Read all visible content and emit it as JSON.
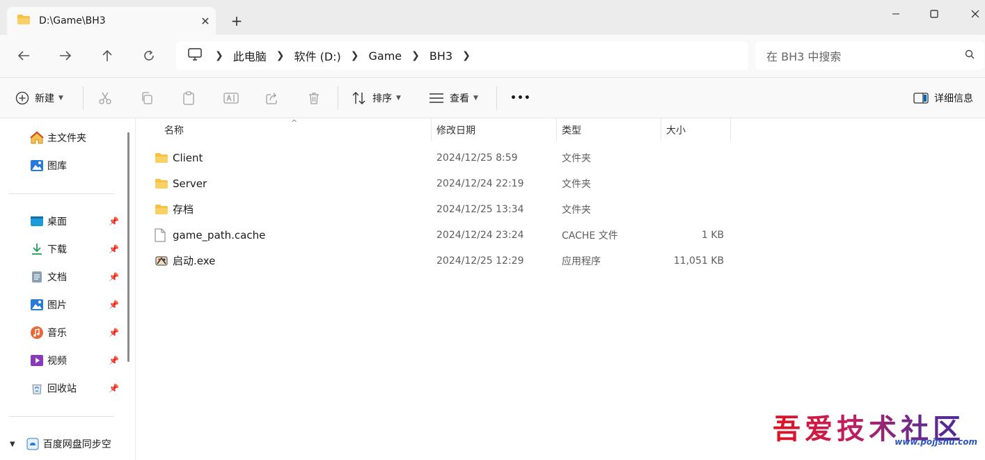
{
  "tab": {
    "title": "D:\\Game\\BH3",
    "close": "✕",
    "new_tab": "+"
  },
  "window": {
    "minimize": "—",
    "maximize": "☐",
    "close": "✕"
  },
  "breadcrumb": [
    "此电脑",
    "软件 (D:)",
    "Game",
    "BH3"
  ],
  "search": {
    "placeholder": "在 BH3 中搜索"
  },
  "toolbar": {
    "new_label": "新建",
    "sort_label": "排序",
    "view_label": "查看",
    "more_label": "•••",
    "details_label": "详细信息"
  },
  "sidebar": {
    "home": "主文件夹",
    "gallery": "图库",
    "pinned": [
      "桌面",
      "下载",
      "文档",
      "图片",
      "音乐",
      "视频",
      "回收站"
    ],
    "cloud": "百度网盘同步空"
  },
  "columns": {
    "name": "名称",
    "date": "修改日期",
    "type": "类型",
    "size": "大小"
  },
  "files": [
    {
      "name": "Client",
      "date": "2024/12/25 8:59",
      "type": "文件夹",
      "size": "",
      "icon": "folder-icon"
    },
    {
      "name": "Server",
      "date": "2024/12/24 22:19",
      "type": "文件夹",
      "size": "",
      "icon": "folder-icon"
    },
    {
      "name": "存档",
      "date": "2024/12/25 13:34",
      "type": "文件夹",
      "size": "",
      "icon": "folder-icon"
    },
    {
      "name": "game_path.cache",
      "date": "2024/12/24 23:24",
      "type": "CACHE 文件",
      "size": "1 KB",
      "icon": "file-icon"
    },
    {
      "name": "启动.exe",
      "date": "2024/12/25 12:29",
      "type": "应用程序",
      "size": "11,051 KB",
      "icon": "exe-icon"
    }
  ],
  "watermark": {
    "text": "吾爱技术社区",
    "url": "www.pojjshu.com"
  },
  "colors": {
    "folder": "#f5c242",
    "accent": "#0067c0",
    "titlebar": "#ececec",
    "panel": "#f9f9f9"
  }
}
